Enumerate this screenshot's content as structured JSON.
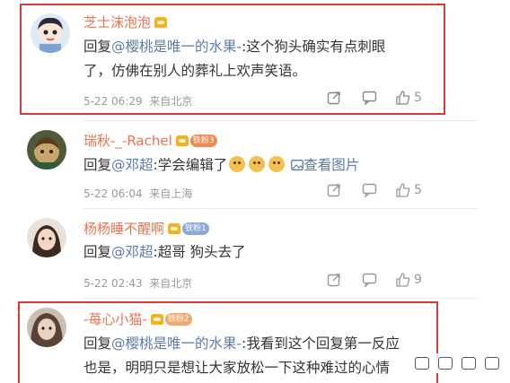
{
  "comments": [
    {
      "name": "芝士沫泡泡",
      "reply_prefix": "回复",
      "mention": "@樱桃是唯一的水果-",
      "text_line1": ":这个狗头确实有点刺眼",
      "text_line2": "了，仿佛在别人的葬礼上欢声笑语。",
      "time": "5-22 06:29",
      "location": "来自北京",
      "likes": "5"
    },
    {
      "name": "瑞秋-_-Rachel",
      "badge": "铁粉3",
      "reply_prefix": "回复",
      "mention": "@邓超",
      "text": ":学会编辑了",
      "view_image": "查看图片",
      "time": "5-22 06:04",
      "location": "来自上海",
      "likes": "5"
    },
    {
      "name": "杨杨睡不醒啊",
      "badge": "铁粉1",
      "reply_prefix": "回复",
      "mention": "@邓超",
      "text": ":超哥 狗头去了",
      "time": "5-22 02:43",
      "location": "来自北京",
      "likes": "9"
    },
    {
      "name": "-苺心小猫-",
      "badge": "铁粉2",
      "reply_prefix": "回复",
      "mention": "@樱桃是唯一的水果-",
      "text_line1": ":我看到这个回复第一反应",
      "text_line2": "也是，明明只是想让大家放松一下这种难过的心情"
    }
  ],
  "colors": {
    "name": "#eb7350",
    "mention": "#5b7aa8",
    "highlight_box": "#d83a3a",
    "badge_3": "#f08a55",
    "badge_1": "#8fa8d8",
    "badge_2": "#f3a96b"
  },
  "icons": [
    "share-icon",
    "comment-icon",
    "like-icon",
    "image-icon",
    "dog-emoji-icon"
  ]
}
